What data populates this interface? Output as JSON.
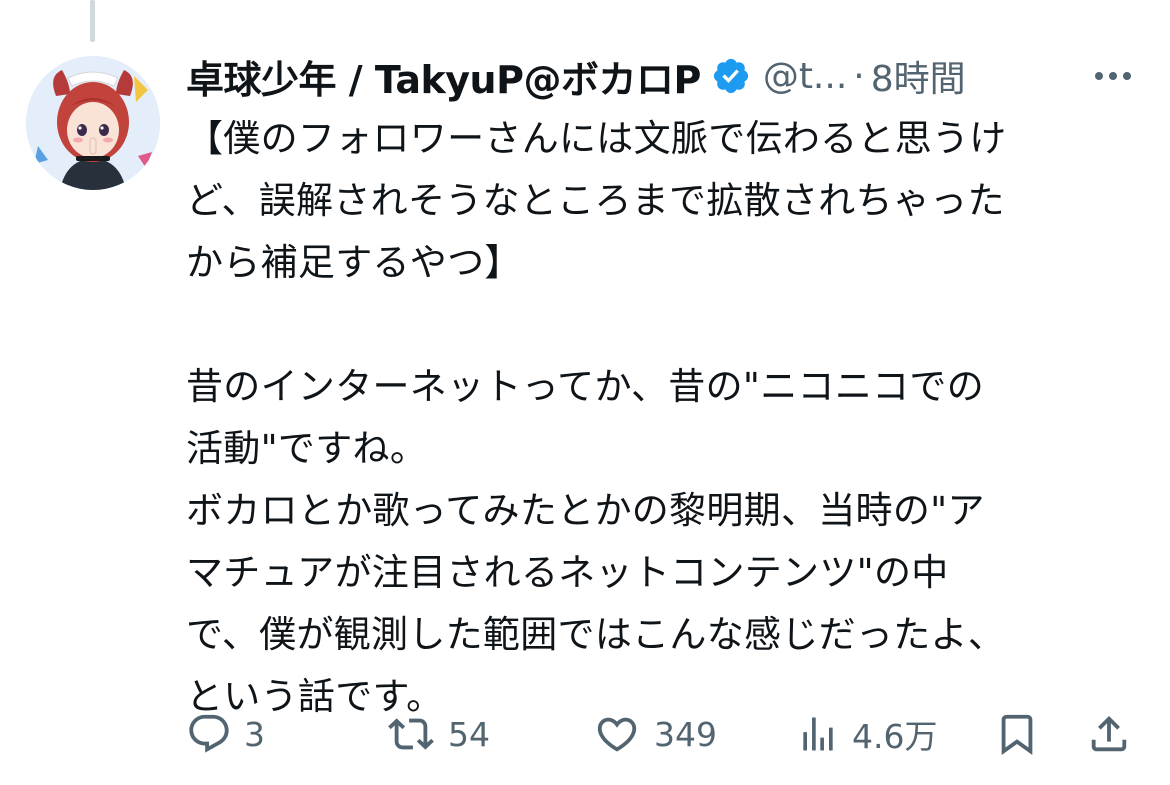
{
  "author": {
    "display_name": "卓球少年 / TakyuP@ボカロP",
    "handle": "@t...",
    "separator": "·",
    "time": "8時間",
    "verified": true,
    "verified_color": "#1d9bf0"
  },
  "tweet": {
    "lines": [
      "【僕のフォロワーさんには文脈で伝わると思うけ",
      "ど、誤解されそうなところまで拡散されちゃった",
      "から補足するやつ】",
      "",
      "昔のインターネットってか、昔の\"ニコニコでの",
      "活動\"ですね。",
      "ボカロとか歌ってみたとかの黎明期、当時の\"ア",
      "マチュアが注目されるネットコンテンツ\"の中",
      "で、僕が観測した範囲ではこんな感じだったよ、",
      "という話です。"
    ]
  },
  "actions": {
    "reply": {
      "icon": "reply-icon",
      "count": "3"
    },
    "retweet": {
      "icon": "retweet-icon",
      "count": "54"
    },
    "like": {
      "icon": "heart-icon",
      "count": "349"
    },
    "views": {
      "icon": "views-icon",
      "count": "4.6万"
    },
    "bookmark": {
      "icon": "bookmark-icon"
    },
    "share": {
      "icon": "share-icon"
    }
  },
  "colors": {
    "text": "#0f1419",
    "muted": "#536471",
    "thread_line": "#cfd9de"
  }
}
